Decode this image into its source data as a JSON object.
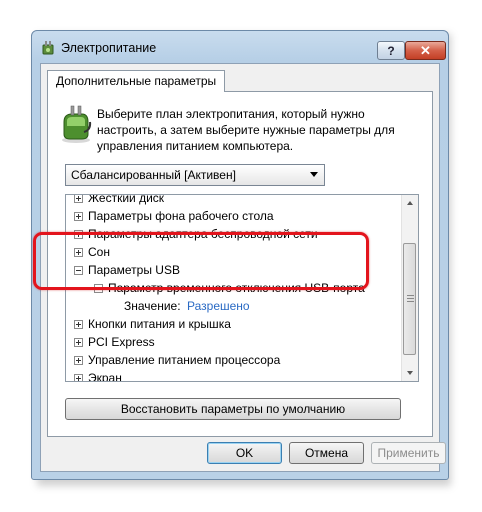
{
  "window": {
    "title": "Электропитание",
    "help_label": "?",
    "close_label": "✕"
  },
  "tab": {
    "label": "Дополнительные параметры"
  },
  "description": "Выберите план электропитания, который нужно настроить, а затем выберите нужные параметры для управления питанием компьютера.",
  "plan_select": {
    "value": "Сбалансированный [Активен]"
  },
  "tree": {
    "items": [
      {
        "label": "Жесткий диск",
        "level": 0,
        "expanded": false
      },
      {
        "label": "Параметры фона рабочего стола",
        "level": 0,
        "expanded": false
      },
      {
        "label": "Параметры адаптера беспроводной сети",
        "level": 0,
        "expanded": false
      },
      {
        "label": "Сон",
        "level": 0,
        "expanded": false
      },
      {
        "label": "Параметры USB",
        "level": 0,
        "expanded": true
      },
      {
        "label": "Параметр временного отключения USB-порта",
        "level": 1,
        "expanded": true
      },
      {
        "label": "Значение:",
        "value": "Разрешено",
        "level": 2
      },
      {
        "label": "Кнопки питания и крышка",
        "level": 0,
        "expanded": false
      },
      {
        "label": "PCI Express",
        "level": 0,
        "expanded": false
      },
      {
        "label": "Управление питанием процессора",
        "level": 0,
        "expanded": false
      },
      {
        "label": "Экран",
        "level": 0,
        "expanded": false
      }
    ]
  },
  "buttons": {
    "restore_label": "Восстановить параметры по умолчанию",
    "ok_label": "OK",
    "cancel_label": "Отмена",
    "apply_label": "Применить"
  },
  "colors": {
    "highlight": "#e3141c",
    "value_link": "#2a6ac4"
  }
}
